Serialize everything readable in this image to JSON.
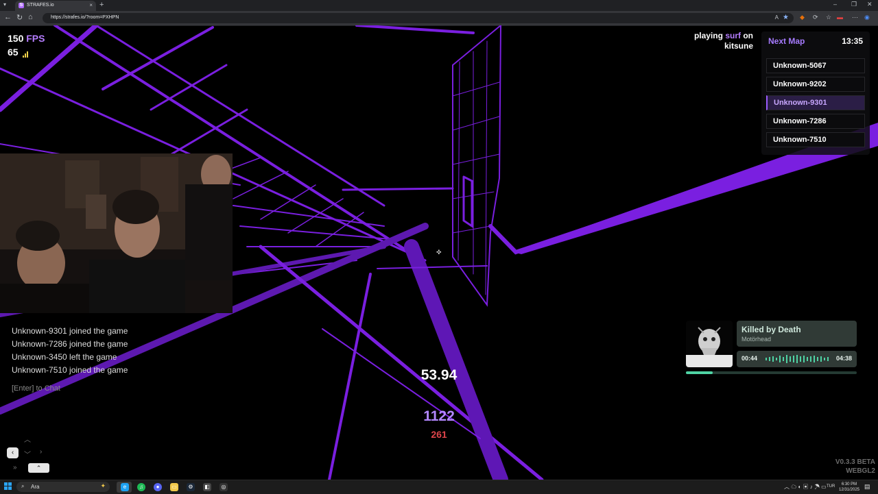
{
  "browser": {
    "tab_title": "STRAFES.io",
    "tab_favicon": "S",
    "url": "https://strafes.io/?room=PXHPN",
    "new_tab_symbol": "+",
    "close_tab_symbol": "×"
  },
  "hud": {
    "fps_value": "150",
    "fps_unit": "FPS",
    "ping": "65",
    "playing_prefix": "playing",
    "mode": "surf",
    "on_word": "on",
    "map_name": "kitsune"
  },
  "next_map": {
    "title": "Next Map",
    "time": "13:35",
    "items": [
      {
        "label": "Unknown-5067"
      },
      {
        "label": "Unknown-9202"
      },
      {
        "label": "Unknown-9301"
      },
      {
        "label": "Unknown-7286"
      },
      {
        "label": "Unknown-7510"
      }
    ],
    "selected_index": 2
  },
  "chat": {
    "lines": [
      "Unknown-9301 joined the game",
      "Unknown-7286 joined the game",
      "Unknown-3450 left the game",
      "Unknown-7510 joined the game"
    ],
    "hint": "[Enter] to Chat"
  },
  "center": {
    "timer": "53.94",
    "speed": "1122",
    "gain": "261"
  },
  "music": {
    "title": "Killed by Death",
    "artist": "Motörhead",
    "current": "00:44",
    "total": "04:38",
    "progress": 0.158
  },
  "version": {
    "line1": "V0.3.3 BETA",
    "line2": "WEBGL2"
  },
  "taskbar": {
    "search_placeholder": "Ara",
    "lang": "TUR",
    "time": "6:30 PM",
    "date": "12/31/2025"
  },
  "colors": {
    "accent": "#9b5cff",
    "scene_purple": "#7a1fe0",
    "speed": "#b388ff",
    "gain": "#e0454b"
  }
}
